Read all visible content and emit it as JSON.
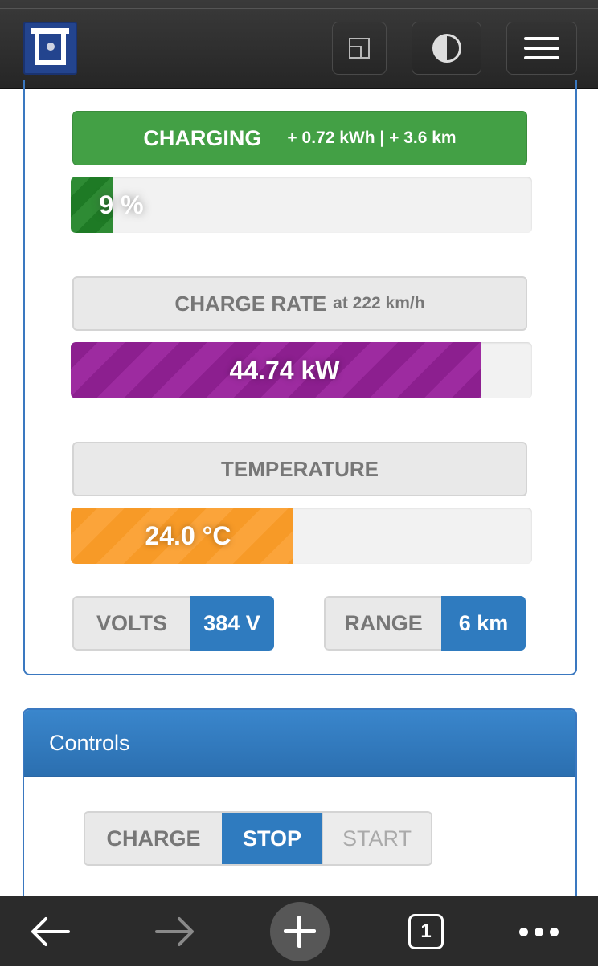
{
  "header": {
    "logo_icon": "square-frame-logo-icon",
    "fullscreen_icon": "fullscreen-icon",
    "theme_icon": "contrast-icon",
    "menu_icon": "hamburger-menu-icon"
  },
  "status": {
    "charging_label": "CHARGING",
    "charging_added": "+ 0.72 kWh | + 3.6 km",
    "soc_text": "9 %",
    "soc_percent": 9,
    "charge_rate_label": "CHARGE RATE",
    "charge_rate_speed": "at 222 km/h",
    "charge_rate_text": "44.74 kW",
    "charge_rate_fraction": 0.89,
    "temperature_label": "TEMPERATURE",
    "temperature_text": "24.0 °C",
    "temperature_fraction": 0.48,
    "volts_label": "VOLTS",
    "volts_value": "384 V",
    "range_label": "RANGE",
    "range_value": "6 km"
  },
  "controls": {
    "title": "Controls",
    "charge_label": "CHARGE",
    "stop_label": "STOP",
    "start_label": "START"
  },
  "browser_bar": {
    "back_icon": "arrow-left-icon",
    "forward_icon": "arrow-right-icon",
    "new_tab_icon": "plus-icon",
    "tab_count": "1",
    "more_icon": "more-dots-icon"
  },
  "colors": {
    "charging_green": "#43a045",
    "soc_green": "#2e8b34",
    "rate_purple": "#8c1f8f",
    "temp_orange": "#f79a27",
    "value_blue": "#2f7bbf",
    "panel_border": "#3a78c0"
  }
}
